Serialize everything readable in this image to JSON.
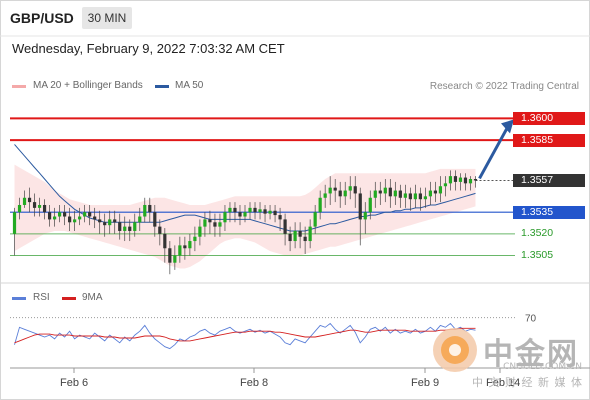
{
  "header": {
    "symbol": "GBP/USD",
    "timeframe": "30 MIN",
    "datetime": "Wednesday, February 9, 2022 7:03:32 AM CET"
  },
  "legend": {
    "bb_label": "MA 20 + Bollinger Bands",
    "ma50_label": "MA 50",
    "rsi_label": "RSI",
    "rsi_ma_label": "9MA"
  },
  "credit": "Research © 2022 Trading Central",
  "watermark": {
    "brand": "中金网",
    "sub": "中 文 财 经 新 媒 体",
    "site": "CNGOLD.COM.CN"
  },
  "colors": {
    "candle": "#22aa22",
    "resistance": "#e01818",
    "support_main": "#2255cc",
    "support": "#2a9a2a",
    "ma50": "#2c5aa0",
    "bands": "#f4a9a9",
    "rsi": "#5b7fd8",
    "rsi_ma": "#d42020",
    "arrow": "#2c5aa0"
  },
  "chart_data": {
    "type": "candlestick",
    "x_tick_labels": [
      "Feb 6",
      "Feb 8",
      "Feb 9",
      "Feb 14"
    ],
    "price_levels": [
      {
        "label": "1.3600",
        "value": 1.36,
        "kind": "resistance"
      },
      {
        "label": "1.3585",
        "value": 1.3585,
        "kind": "resistance"
      },
      {
        "label": "1.3557",
        "value": 1.3557,
        "kind": "last"
      },
      {
        "label": "1.3535",
        "value": 1.3535,
        "kind": "support_main"
      },
      {
        "label": "1.3520",
        "value": 1.352,
        "kind": "support"
      },
      {
        "label": "1.3505",
        "value": 1.3505,
        "kind": "support"
      }
    ],
    "ylim": [
      1.3488,
      1.361
    ],
    "candles": [
      [
        1.352,
        1.3535,
        1.3505,
        1.3538
      ],
      [
        1.3535,
        1.354,
        1.353,
        1.3545
      ],
      [
        1.354,
        1.3545,
        1.3538,
        1.355
      ],
      [
        1.3545,
        1.3542,
        1.3535,
        1.3552
      ],
      [
        1.3542,
        1.3538,
        1.3532,
        1.3548
      ],
      [
        1.3538,
        1.354,
        1.3532,
        1.3545
      ],
      [
        1.354,
        1.3535,
        1.353,
        1.3544
      ],
      [
        1.3535,
        1.353,
        1.3525,
        1.354
      ],
      [
        1.353,
        1.3532,
        1.3525,
        1.3538
      ],
      [
        1.3532,
        1.3535,
        1.3528,
        1.354
      ],
      [
        1.3535,
        1.3532,
        1.3526,
        1.354
      ],
      [
        1.3532,
        1.3528,
        1.3522,
        1.3538
      ],
      [
        1.3528,
        1.353,
        1.3522,
        1.3536
      ],
      [
        1.353,
        1.3532,
        1.3526,
        1.3538
      ],
      [
        1.3532,
        1.3535,
        1.3528,
        1.354
      ],
      [
        1.3535,
        1.3532,
        1.3526,
        1.354
      ],
      [
        1.3532,
        1.353,
        1.3524,
        1.3538
      ],
      [
        1.353,
        1.3528,
        1.352,
        1.3536
      ],
      [
        1.3528,
        1.3526,
        1.3518,
        1.3534
      ],
      [
        1.3526,
        1.353,
        1.352,
        1.3536
      ],
      [
        1.353,
        1.3528,
        1.352,
        1.3536
      ],
      [
        1.3528,
        1.3522,
        1.3516,
        1.3534
      ],
      [
        1.3522,
        1.3525,
        1.3515,
        1.3532
      ],
      [
        1.3525,
        1.3522,
        1.3515,
        1.353
      ],
      [
        1.3522,
        1.3528,
        1.3518,
        1.3534
      ],
      [
        1.3528,
        1.3532,
        1.3522,
        1.3538
      ],
      [
        1.3532,
        1.354,
        1.3528,
        1.3545
      ],
      [
        1.354,
        1.3535,
        1.3528,
        1.3545
      ],
      [
        1.3535,
        1.3525,
        1.3518,
        1.354
      ],
      [
        1.3525,
        1.352,
        1.3512,
        1.353
      ],
      [
        1.352,
        1.351,
        1.35,
        1.3524
      ],
      [
        1.351,
        1.35,
        1.3492,
        1.3515
      ],
      [
        1.35,
        1.3505,
        1.3495,
        1.3512
      ],
      [
        1.3505,
        1.3512,
        1.35,
        1.3518
      ],
      [
        1.3512,
        1.351,
        1.3502,
        1.3518
      ],
      [
        1.351,
        1.3515,
        1.3505,
        1.352
      ],
      [
        1.3515,
        1.3518,
        1.3508,
        1.3525
      ],
      [
        1.3518,
        1.3525,
        1.3512,
        1.353
      ],
      [
        1.3525,
        1.353,
        1.3518,
        1.3535
      ],
      [
        1.353,
        1.3528,
        1.352,
        1.3536
      ],
      [
        1.3528,
        1.3525,
        1.3518,
        1.3534
      ],
      [
        1.3525,
        1.3528,
        1.3518,
        1.3534
      ],
      [
        1.3528,
        1.3535,
        1.3522,
        1.354
      ],
      [
        1.3535,
        1.3538,
        1.3528,
        1.3542
      ],
      [
        1.3538,
        1.3535,
        1.3528,
        1.3542
      ],
      [
        1.3535,
        1.3532,
        1.3526,
        1.354
      ],
      [
        1.3532,
        1.3535,
        1.3528,
        1.354
      ],
      [
        1.3535,
        1.3538,
        1.353,
        1.3542
      ],
      [
        1.3538,
        1.3535,
        1.353,
        1.3542
      ],
      [
        1.3535,
        1.3537,
        1.353,
        1.3542
      ],
      [
        1.3537,
        1.3534,
        1.3528,
        1.354
      ],
      [
        1.3534,
        1.3536,
        1.353,
        1.354
      ],
      [
        1.3536,
        1.3533,
        1.3528,
        1.354
      ],
      [
        1.3533,
        1.353,
        1.3522,
        1.3538
      ],
      [
        1.353,
        1.352,
        1.3512,
        1.3534
      ],
      [
        1.352,
        1.3515,
        1.3508,
        1.3525
      ],
      [
        1.3515,
        1.3522,
        1.351,
        1.3528
      ],
      [
        1.3522,
        1.3518,
        1.351,
        1.3528
      ],
      [
        1.3518,
        1.3515,
        1.3506,
        1.3525
      ],
      [
        1.3515,
        1.3525,
        1.351,
        1.353
      ],
      [
        1.3525,
        1.3535,
        1.352,
        1.354
      ],
      [
        1.3535,
        1.3545,
        1.353,
        1.355
      ],
      [
        1.3545,
        1.3548,
        1.3538,
        1.3554
      ],
      [
        1.3548,
        1.3552,
        1.354,
        1.356
      ],
      [
        1.3552,
        1.355,
        1.3542,
        1.3558
      ],
      [
        1.355,
        1.3546,
        1.3538,
        1.3556
      ],
      [
        1.3546,
        1.355,
        1.354,
        1.3556
      ],
      [
        1.355,
        1.3553,
        1.3544,
        1.356
      ],
      [
        1.3553,
        1.3548,
        1.3538,
        1.356
      ],
      [
        1.3548,
        1.353,
        1.3512,
        1.3552
      ],
      [
        1.353,
        1.3535,
        1.352,
        1.3542
      ],
      [
        1.3535,
        1.3545,
        1.353,
        1.355
      ],
      [
        1.3545,
        1.355,
        1.3538,
        1.3556
      ],
      [
        1.355,
        1.3548,
        1.354,
        1.3556
      ],
      [
        1.3548,
        1.3552,
        1.3542,
        1.3558
      ],
      [
        1.3552,
        1.3546,
        1.3538,
        1.3558
      ],
      [
        1.3546,
        1.355,
        1.354,
        1.3556
      ],
      [
        1.355,
        1.3545,
        1.3538,
        1.3554
      ],
      [
        1.3545,
        1.3548,
        1.3538,
        1.3554
      ],
      [
        1.3548,
        1.3544,
        1.3536,
        1.3552
      ],
      [
        1.3544,
        1.3548,
        1.3538,
        1.3554
      ],
      [
        1.3548,
        1.3544,
        1.3536,
        1.3552
      ],
      [
        1.3544,
        1.3546,
        1.3538,
        1.3552
      ],
      [
        1.3546,
        1.355,
        1.354,
        1.3556
      ],
      [
        1.355,
        1.3548,
        1.3542,
        1.3556
      ],
      [
        1.3548,
        1.3553,
        1.3542,
        1.356
      ],
      [
        1.3553,
        1.3555,
        1.3546,
        1.356
      ],
      [
        1.3555,
        1.356,
        1.355,
        1.3564
      ],
      [
        1.356,
        1.3556,
        1.355,
        1.3564
      ],
      [
        1.3556,
        1.3559,
        1.355,
        1.3562
      ],
      [
        1.3559,
        1.3555,
        1.355,
        1.3562
      ],
      [
        1.3555,
        1.3558,
        1.355,
        1.356
      ],
      [
        1.3558,
        1.3557,
        1.3552,
        1.356
      ]
    ],
    "ma50": [
      1.3582,
      1.3578,
      1.3574,
      1.357,
      1.3566,
      1.3562,
      1.3558,
      1.3554,
      1.355,
      1.3546,
      1.3543,
      1.354,
      1.3537,
      1.3535,
      1.3533,
      1.3531,
      1.353,
      1.3529,
      1.3528,
      1.3528,
      1.3528,
      1.3528,
      1.3528,
      1.3528,
      1.3528,
      1.3528,
      1.3528,
      1.3528,
      1.3528,
      1.3528,
      1.3529,
      1.353,
      1.3531,
      1.3532,
      1.3533,
      1.3533,
      1.3533,
      1.3532,
      1.3531,
      1.353,
      1.353,
      1.353,
      1.353,
      1.353,
      1.353,
      1.353,
      1.353,
      1.353,
      1.3529,
      1.3528,
      1.3527,
      1.3526,
      1.3525,
      1.3524,
      1.3523,
      1.3522,
      1.3522,
      1.3522,
      1.3522,
      1.3523,
      1.3524,
      1.3525,
      1.3526,
      1.3527,
      1.3527,
      1.3528,
      1.3529,
      1.353,
      1.3531,
      1.3532,
      1.3532,
      1.3533,
      1.3533,
      1.3534,
      1.3535,
      1.3535,
      1.3536,
      1.3536,
      1.3537,
      1.3537,
      1.3538,
      1.3538,
      1.3539,
      1.354,
      1.354,
      1.3541,
      1.3542,
      1.3543,
      1.3544,
      1.3545,
      1.3546,
      1.3547,
      1.3548
    ],
    "bb_upper": [
      1.3568,
      1.3566,
      1.3564,
      1.3562,
      1.356,
      1.3558,
      1.3556,
      1.3553,
      1.355,
      1.3548,
      1.3546,
      1.3544,
      1.3543,
      1.3542,
      1.3541,
      1.354,
      1.354,
      1.354,
      1.354,
      1.354,
      1.354,
      1.354,
      1.354,
      1.354,
      1.3541,
      1.3542,
      1.3543,
      1.3544,
      1.3545,
      1.3545,
      1.3545,
      1.3544,
      1.3543,
      1.3542,
      1.3541,
      1.354,
      1.354,
      1.354,
      1.354,
      1.3541,
      1.3542,
      1.3543,
      1.3544,
      1.3545,
      1.3546,
      1.3546,
      1.3546,
      1.3546,
      1.3546,
      1.3546,
      1.3546,
      1.3546,
      1.3546,
      1.3546,
      1.3546,
      1.3546,
      1.3546,
      1.3546,
      1.3547,
      1.3549,
      1.3552,
      1.3555,
      1.3558,
      1.356,
      1.3562,
      1.3562,
      1.3562,
      1.3562,
      1.3562,
      1.3562,
      1.3562,
      1.3562,
      1.3562,
      1.3562,
      1.3562,
      1.3562,
      1.3562,
      1.3562,
      1.3562,
      1.3562,
      1.3562,
      1.3562,
      1.3562,
      1.3563,
      1.3564,
      1.3565,
      1.3565,
      1.3565,
      1.3565,
      1.3565,
      1.3565,
      1.3565,
      1.3565
    ],
    "bb_lower": [
      1.3508,
      1.351,
      1.3512,
      1.3514,
      1.3516,
      1.3518,
      1.352,
      1.3521,
      1.3522,
      1.3522,
      1.3522,
      1.3521,
      1.352,
      1.3519,
      1.3518,
      1.3517,
      1.3516,
      1.3515,
      1.3514,
      1.3513,
      1.3512,
      1.3511,
      1.351,
      1.3509,
      1.3508,
      1.3507,
      1.3506,
      1.3505,
      1.3504,
      1.3502,
      1.35,
      1.3498,
      1.3497,
      1.3496,
      1.3496,
      1.3497,
      1.3499,
      1.3501,
      1.3504,
      1.3507,
      1.351,
      1.3513,
      1.3515,
      1.3516,
      1.3517,
      1.3517,
      1.3516,
      1.3515,
      1.3514,
      1.3512,
      1.351,
      1.3508,
      1.3507,
      1.3506,
      1.3505,
      1.3505,
      1.3505,
      1.3505,
      1.3506,
      1.3507,
      1.3508,
      1.3509,
      1.351,
      1.3511,
      1.3511,
      1.3512,
      1.3513,
      1.3514,
      1.3515,
      1.3516,
      1.3517,
      1.3518,
      1.3519,
      1.352,
      1.3521,
      1.3522,
      1.3523,
      1.3524,
      1.3525,
      1.3526,
      1.3527,
      1.3528,
      1.3529,
      1.353,
      1.3531,
      1.3532,
      1.3533,
      1.3534,
      1.3535,
      1.3536,
      1.3537,
      1.3538,
      1.3539
    ],
    "rsi": {
      "ylim": [
        20,
        80
      ],
      "level": 70,
      "level_label": "70",
      "values": [
        42,
        60,
        58,
        56,
        54,
        52,
        50,
        52,
        48,
        54,
        50,
        56,
        48,
        52,
        50,
        48,
        54,
        50,
        46,
        52,
        48,
        44,
        50,
        46,
        52,
        56,
        62,
        54,
        48,
        44,
        40,
        38,
        42,
        48,
        46,
        50,
        52,
        56,
        58,
        54,
        52,
        56,
        58,
        60,
        56,
        54,
        56,
        58,
        55,
        57,
        54,
        56,
        53,
        50,
        44,
        42,
        48,
        46,
        44,
        50,
        56,
        62,
        60,
        64,
        58,
        54,
        58,
        62,
        55,
        44,
        50,
        58,
        60,
        56,
        60,
        54,
        58,
        54,
        56,
        54,
        58,
        54,
        56,
        60,
        56,
        62,
        60,
        64,
        58,
        60,
        56,
        58,
        57
      ],
      "ma": [
        44,
        46,
        48,
        50,
        52,
        53,
        53,
        53,
        52,
        52,
        52,
        52,
        51,
        51,
        51,
        51,
        51,
        51,
        50,
        50,
        50,
        49,
        49,
        49,
        49,
        50,
        51,
        51,
        51,
        51,
        50,
        48,
        47,
        46,
        46,
        46,
        47,
        48,
        49,
        50,
        51,
        52,
        53,
        54,
        55,
        55,
        55,
        56,
        56,
        56,
        56,
        56,
        55,
        55,
        54,
        53,
        52,
        51,
        50,
        50,
        50,
        51,
        52,
        53,
        54,
        55,
        56,
        57,
        57,
        56,
        55,
        55,
        56,
        57,
        57,
        57,
        57,
        57,
        57,
        56,
        56,
        56,
        56,
        56,
        56,
        57,
        57,
        58,
        58,
        59,
        59,
        59,
        59
      ]
    }
  }
}
